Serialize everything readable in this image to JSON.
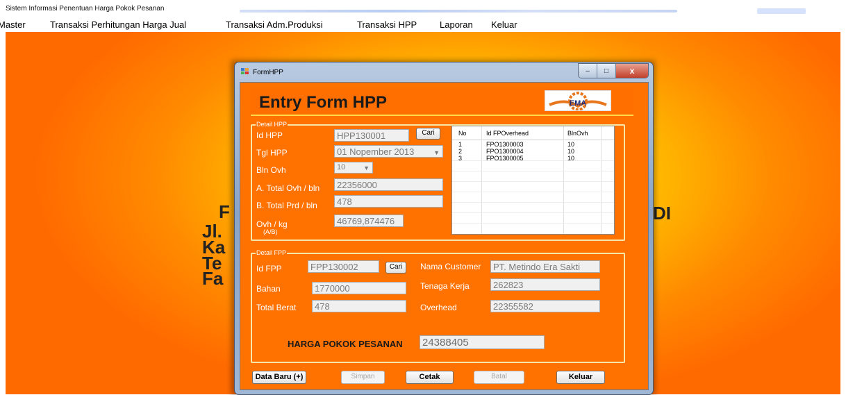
{
  "app": {
    "title": "Sistem Informasi Penentuan Harga Pokok Pesanan"
  },
  "menu": [
    "Master",
    "Transaksi Perhitungan Harga Jual",
    "Transaksi Adm.Produksi",
    "Transaksi HPP",
    "Laporan",
    "Keluar"
  ],
  "background_text": {
    "line1": "F",
    "line2": "Jl.",
    "line3": "Ka",
    "line4": "Te",
    "line5": "Fa",
    "right": "DI"
  },
  "window": {
    "title": "FormHPP",
    "minimize": "–",
    "maximize": "□",
    "close": "x"
  },
  "form": {
    "title": "Entry Form HPP",
    "logo_text": "EMA",
    "detail_hpp": {
      "caption": "Detail HPP",
      "id_label": "Id HPP",
      "id_value": "HPP130001",
      "cari": "Cari",
      "tgl_label": "Tgl HPP",
      "tgl_value": "01 Nopember 2013",
      "bln_label": "Bln Ovh",
      "bln_value": "10",
      "total_ovh_label": "A. Total Ovh / bln",
      "total_ovh_value": "22356000",
      "total_prd_label": "B. Total Prd / bln",
      "total_prd_value": "478",
      "ovh_kg_label": "Ovh / kg",
      "ovh_kg_sub": "(A/B)",
      "ovh_kg_value": "46769,874476"
    },
    "grid": {
      "columns": [
        "No",
        "Id FPOverhead",
        "BlnOvh"
      ],
      "rows": [
        [
          "1",
          "FPO1300003",
          "10"
        ],
        [
          "2",
          "FPO1300004",
          "10"
        ],
        [
          "3",
          "FPO1300005",
          "10"
        ]
      ]
    },
    "detail_fpp": {
      "caption": "Detail FPP",
      "id_label": "Id FPP",
      "id_value": "FPP130002",
      "cari": "Cari",
      "customer_label": "Nama Customer",
      "customer_value": "PT. Metindo Era Sakti",
      "bahan_label": "Bahan",
      "bahan_value": "1770000",
      "tk_label": "Tenaga Kerja",
      "tk_value": "262823",
      "berat_label": "Total Berat",
      "berat_value": "478",
      "overhead_label": "Overhead",
      "overhead_value": "22355582",
      "hpp_label": "HARGA POKOK PESANAN",
      "hpp_value": "24388405"
    },
    "buttons": {
      "baru": "Data Baru (+)",
      "simpan": "Simpan",
      "cetak": "Cetak",
      "batal": "Batal",
      "keluar": "Keluar"
    }
  }
}
